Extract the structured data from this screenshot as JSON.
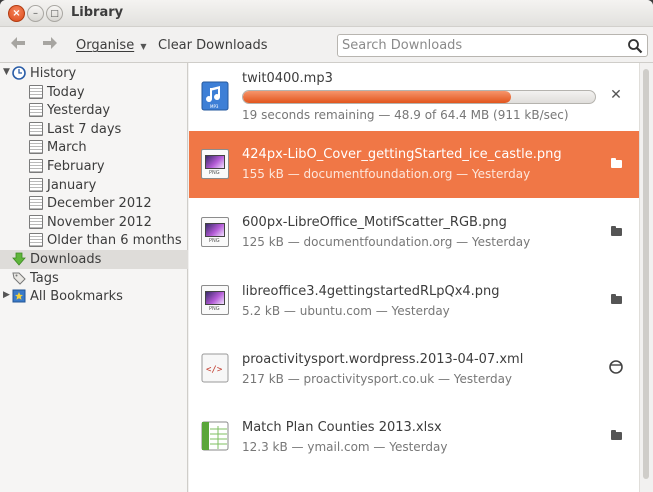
{
  "window": {
    "title": "Library"
  },
  "toolbar": {
    "back_icon": "back-arrow-icon",
    "forward_icon": "forward-arrow-icon",
    "organise_label": "Organise",
    "clear_label": "Clear Downloads",
    "search_placeholder": "Search Downloads"
  },
  "sidebar": {
    "history_label": "History",
    "history_children": [
      "Today",
      "Yesterday",
      "Last 7 days",
      "March",
      "February",
      "January",
      "December 2012",
      "November 2012",
      "Older than 6 months"
    ],
    "downloads_label": "Downloads",
    "tags_label": "Tags",
    "bookmarks_label": "All Bookmarks"
  },
  "downloads": [
    {
      "name": "twit0400.mp3",
      "info": "19 seconds remaining — 48.9 of 64.4 MB (911 kB/sec)",
      "progress": 0.76,
      "action": "cancel",
      "icon": "audio-file-icon"
    },
    {
      "name": "424px-LibO_Cover_gettingStarted_ice_castle.png",
      "info": "155 kB — documentfoundation.org — Yesterday",
      "action": "folder",
      "icon": "image-file-icon",
      "selected": true
    },
    {
      "name": "600px-LibreOffice_MotifScatter_RGB.png",
      "info": "125 kB — documentfoundation.org — Yesterday",
      "action": "folder",
      "icon": "image-file-icon"
    },
    {
      "name": "libreoffice3.4gettingstartedRLpQx4.png",
      "info": "5.2 kB — ubuntu.com — Yesterday",
      "action": "folder",
      "icon": "image-file-icon"
    },
    {
      "name": "proactivitysport.wordpress.2013-04-07.xml",
      "info": "217 kB — proactivitysport.co.uk — Yesterday",
      "action": "retry",
      "icon": "xml-file-icon"
    },
    {
      "name": "Match Plan Counties 2013.xlsx",
      "info": "12.3 kB — ymail.com — Yesterday",
      "action": "folder",
      "icon": "spreadsheet-file-icon"
    }
  ],
  "colors": {
    "accent": "#f07746",
    "progress": "#e2551d"
  }
}
